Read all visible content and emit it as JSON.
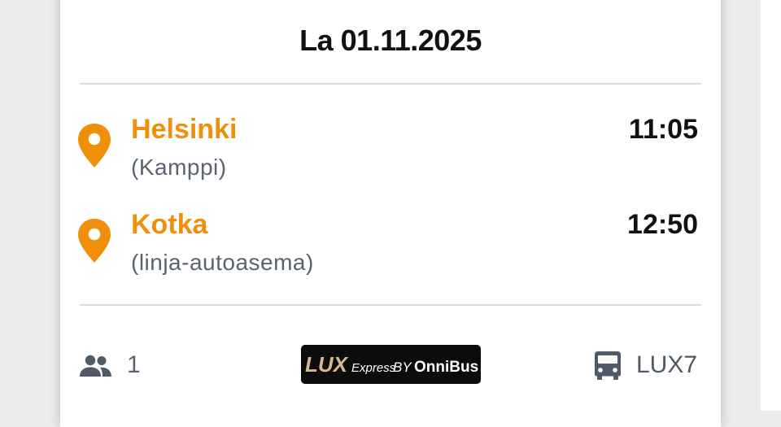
{
  "trip": {
    "date": "La 01.11.2025",
    "departure": {
      "city": "Helsinki",
      "station": "(Kamppi)",
      "time": "11:05"
    },
    "arrival": {
      "city": "Kotka",
      "station": "(linja-autoasema)",
      "time": "12:50"
    }
  },
  "footer": {
    "passengers": "1",
    "passengers_icon": "people-icon",
    "operator_logo": {
      "brand": "LUX",
      "sub": "Express",
      "by": "BY",
      "partner": "OnniBus"
    },
    "route_icon": "bus-icon",
    "route_code": "LUX7"
  },
  "colors": {
    "accent": "#f0900a",
    "muted": "#5a6470",
    "text": "#111111"
  }
}
